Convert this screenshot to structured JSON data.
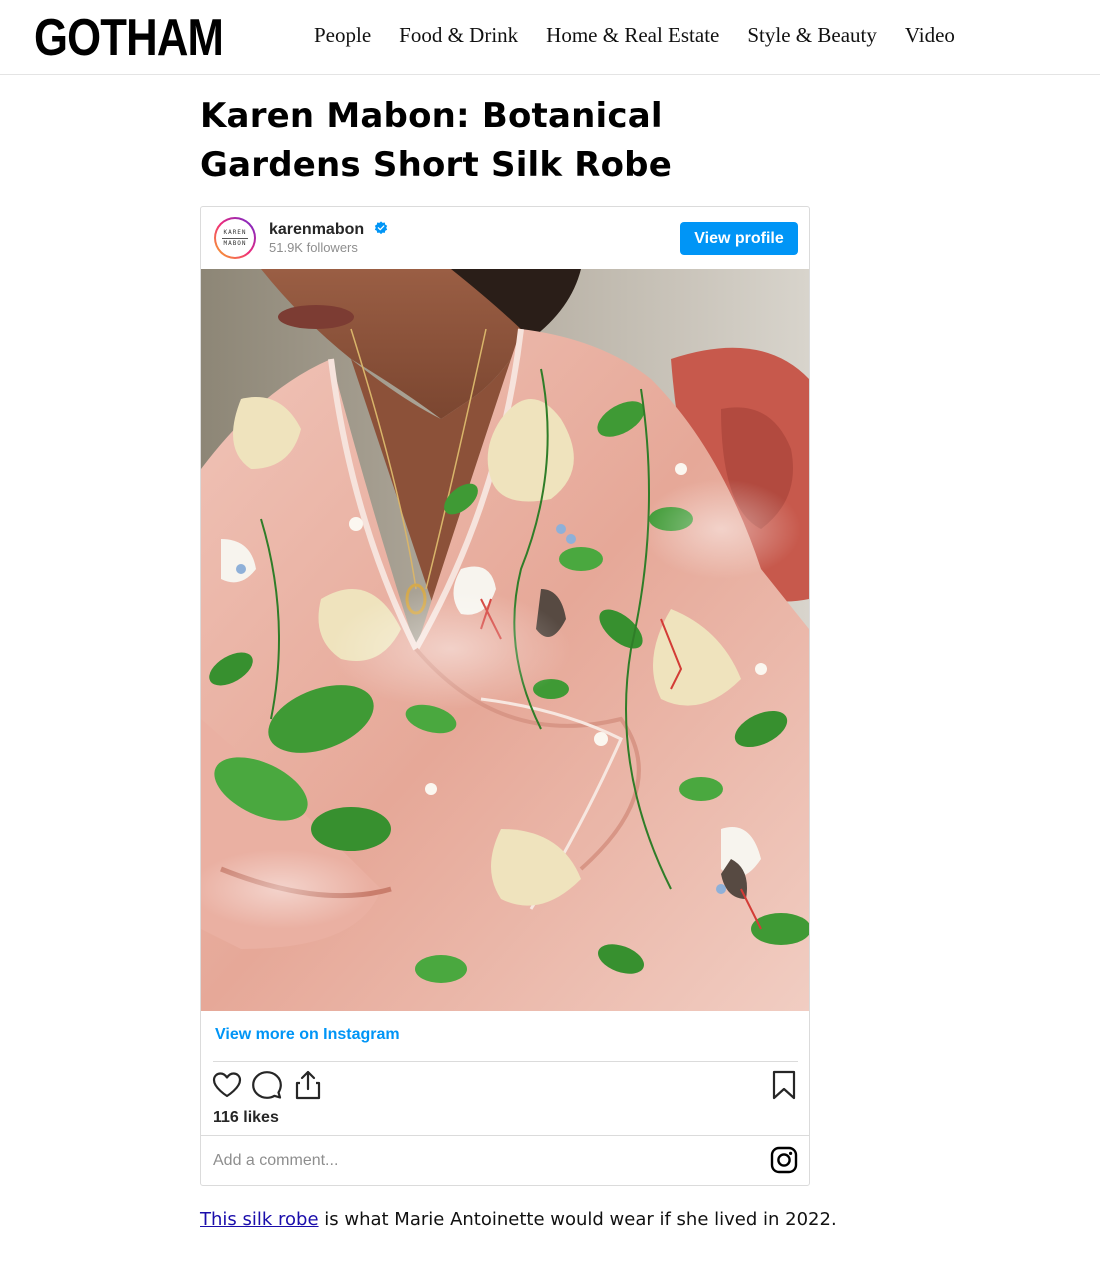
{
  "site": {
    "logo": "GOTHAM"
  },
  "nav": {
    "items": [
      "People",
      "Food & Drink",
      "Home & Real Estate",
      "Style & Beauty",
      "Video"
    ]
  },
  "article": {
    "title": "Karen Mabon: Botanical Gardens Short Silk Robe",
    "caption": {
      "link_text": "This silk robe",
      "rest": " is what Marie Antoinette would wear if she lived in 2022."
    }
  },
  "instagram": {
    "avatar_text_top": "KAREN",
    "avatar_text_bottom": "MABON",
    "username": "karenmabon",
    "verified": true,
    "followers": "51.9K followers",
    "view_profile": "View profile",
    "view_more": "View more on Instagram",
    "likes": "116 likes",
    "comment_placeholder": "Add a comment...",
    "photo_icon": "pink-floral-silk-robe-photo",
    "icons": [
      "heart-icon",
      "comment-icon",
      "share-icon",
      "bookmark-icon",
      "instagram-icon",
      "verified-badge-icon"
    ]
  },
  "colors": {
    "accent": "#0095f6",
    "link": "#1a0dab",
    "muted": "#8e8e8e",
    "border": "#dbdbdb",
    "robe_pink": "#e8b3a6",
    "leaf_green": "#3f9a35"
  }
}
